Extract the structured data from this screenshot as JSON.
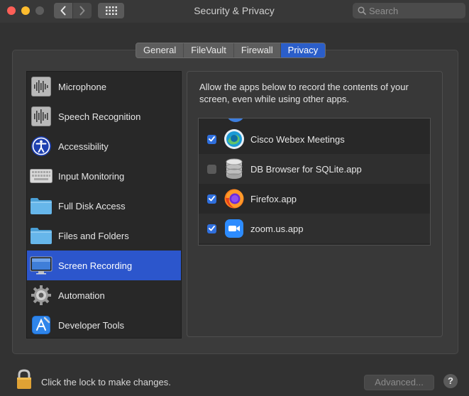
{
  "window": {
    "title": "Security & Privacy"
  },
  "search": {
    "placeholder": "Search"
  },
  "tabs": [
    {
      "label": "General",
      "active": false
    },
    {
      "label": "FileVault",
      "active": false
    },
    {
      "label": "Firewall",
      "active": false
    },
    {
      "label": "Privacy",
      "active": true
    }
  ],
  "sidebar": {
    "items": [
      {
        "label": "Microphone",
        "icon": "microphone-waveform-icon"
      },
      {
        "label": "Speech Recognition",
        "icon": "speech-waveform-icon"
      },
      {
        "label": "Accessibility",
        "icon": "accessibility-icon"
      },
      {
        "label": "Input Monitoring",
        "icon": "keyboard-icon"
      },
      {
        "label": "Full Disk Access",
        "icon": "folder-icon"
      },
      {
        "label": "Files and Folders",
        "icon": "folder-icon"
      },
      {
        "label": "Screen Recording",
        "icon": "display-icon",
        "selected": true
      },
      {
        "label": "Automation",
        "icon": "gear-icon"
      },
      {
        "label": "Developer Tools",
        "icon": "developer-tools-icon"
      }
    ]
  },
  "main": {
    "description": "Allow the apps below to record the contents of your screen, even while using other apps.",
    "apps": [
      {
        "name": "Cisco Webex Meetings",
        "checked": true,
        "icon": "webex-icon"
      },
      {
        "name": "DB Browser for SQLite.app",
        "checked": false,
        "icon": "database-icon"
      },
      {
        "name": "Firefox.app",
        "checked": true,
        "icon": "firefox-icon"
      },
      {
        "name": "zoom.us.app",
        "checked": true,
        "icon": "zoom-icon"
      }
    ]
  },
  "footer": {
    "lock_text": "Click the lock to make changes.",
    "advanced_label": "Advanced...",
    "help_label": "?"
  },
  "colors": {
    "accent": "#2c56cc",
    "checkbox_on": "#2f6fdd"
  }
}
